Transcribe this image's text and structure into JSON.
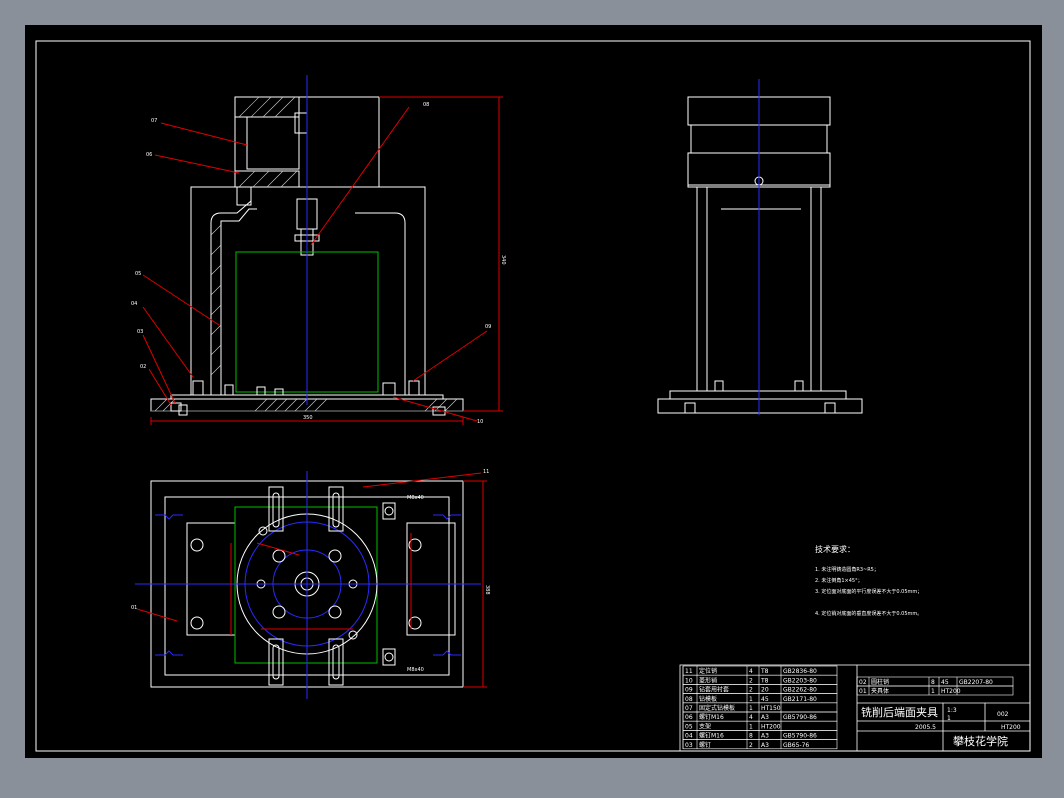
{
  "drawing": {
    "title": "铣削后端面夹具",
    "school": "攀枝花学院",
    "drawing_no": "002",
    "scale": "1:3",
    "sheets": "1",
    "date": "2005.5",
    "material": "HT200"
  },
  "tech_requirements": {
    "title": "技术要求：",
    "lines": [
      "1. 未注明铸造圆角R3~R5；",
      "2. 未注倒角1×45°；",
      "3. 定位面对底面的平行度误差不大于0.05mm；",
      "4. 定位销对底面的垂直度误差不大于0.05mm。"
    ]
  },
  "leaders": [
    "01",
    "02",
    "03",
    "04",
    "05",
    "06",
    "07",
    "08",
    "09",
    "10",
    "11"
  ],
  "dims": {
    "height": "340",
    "width": "350",
    "side": "388",
    "bolt": "M8x40"
  },
  "bom_left": [
    {
      "no": "11",
      "name": "定位销",
      "qty": "4",
      "mat": "T8",
      "std": "GB2836-80"
    },
    {
      "no": "10",
      "name": "菱形销",
      "qty": "2",
      "mat": "T8",
      "std": "GB2203-80"
    },
    {
      "no": "09",
      "name": "钻套用衬套",
      "qty": "2",
      "mat": "20",
      "std": "GB2262-80"
    },
    {
      "no": "08",
      "name": "钻模板",
      "qty": "1",
      "mat": "45",
      "std": "GB2171-80"
    },
    {
      "no": "07",
      "name": "固定式钻模板",
      "qty": "1",
      "mat": "HT150",
      "std": ""
    },
    {
      "no": "06",
      "name": "螺钉M16",
      "qty": "4",
      "mat": "A3",
      "std": "GB5790-86"
    },
    {
      "no": "05",
      "name": "支架",
      "qty": "1",
      "mat": "HT200",
      "std": ""
    },
    {
      "no": "04",
      "name": "螺钉M16",
      "qty": "8",
      "mat": "A3",
      "std": "GB5790-86"
    },
    {
      "no": "03",
      "name": "螺钉",
      "qty": "2",
      "mat": "A3",
      "std": "GB65-76"
    }
  ],
  "bom_right": [
    {
      "no": "02",
      "name": "圆柱销",
      "qty": "8",
      "mat": "45",
      "std": "GB2207-80"
    },
    {
      "no": "01",
      "name": "夹具体",
      "qty": "1",
      "mat": "HT200",
      "std": ""
    }
  ]
}
